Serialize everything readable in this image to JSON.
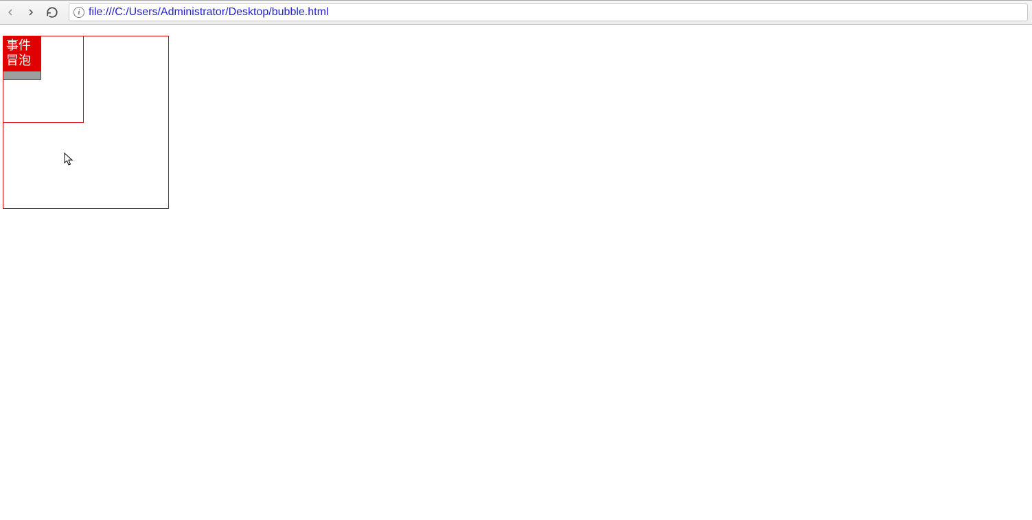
{
  "browser": {
    "url": "file:///C:/Users/Administrator/Desktop/bubble.html",
    "info_icon_label": "i"
  },
  "page": {
    "inner_box_text": "事件冒泡"
  }
}
